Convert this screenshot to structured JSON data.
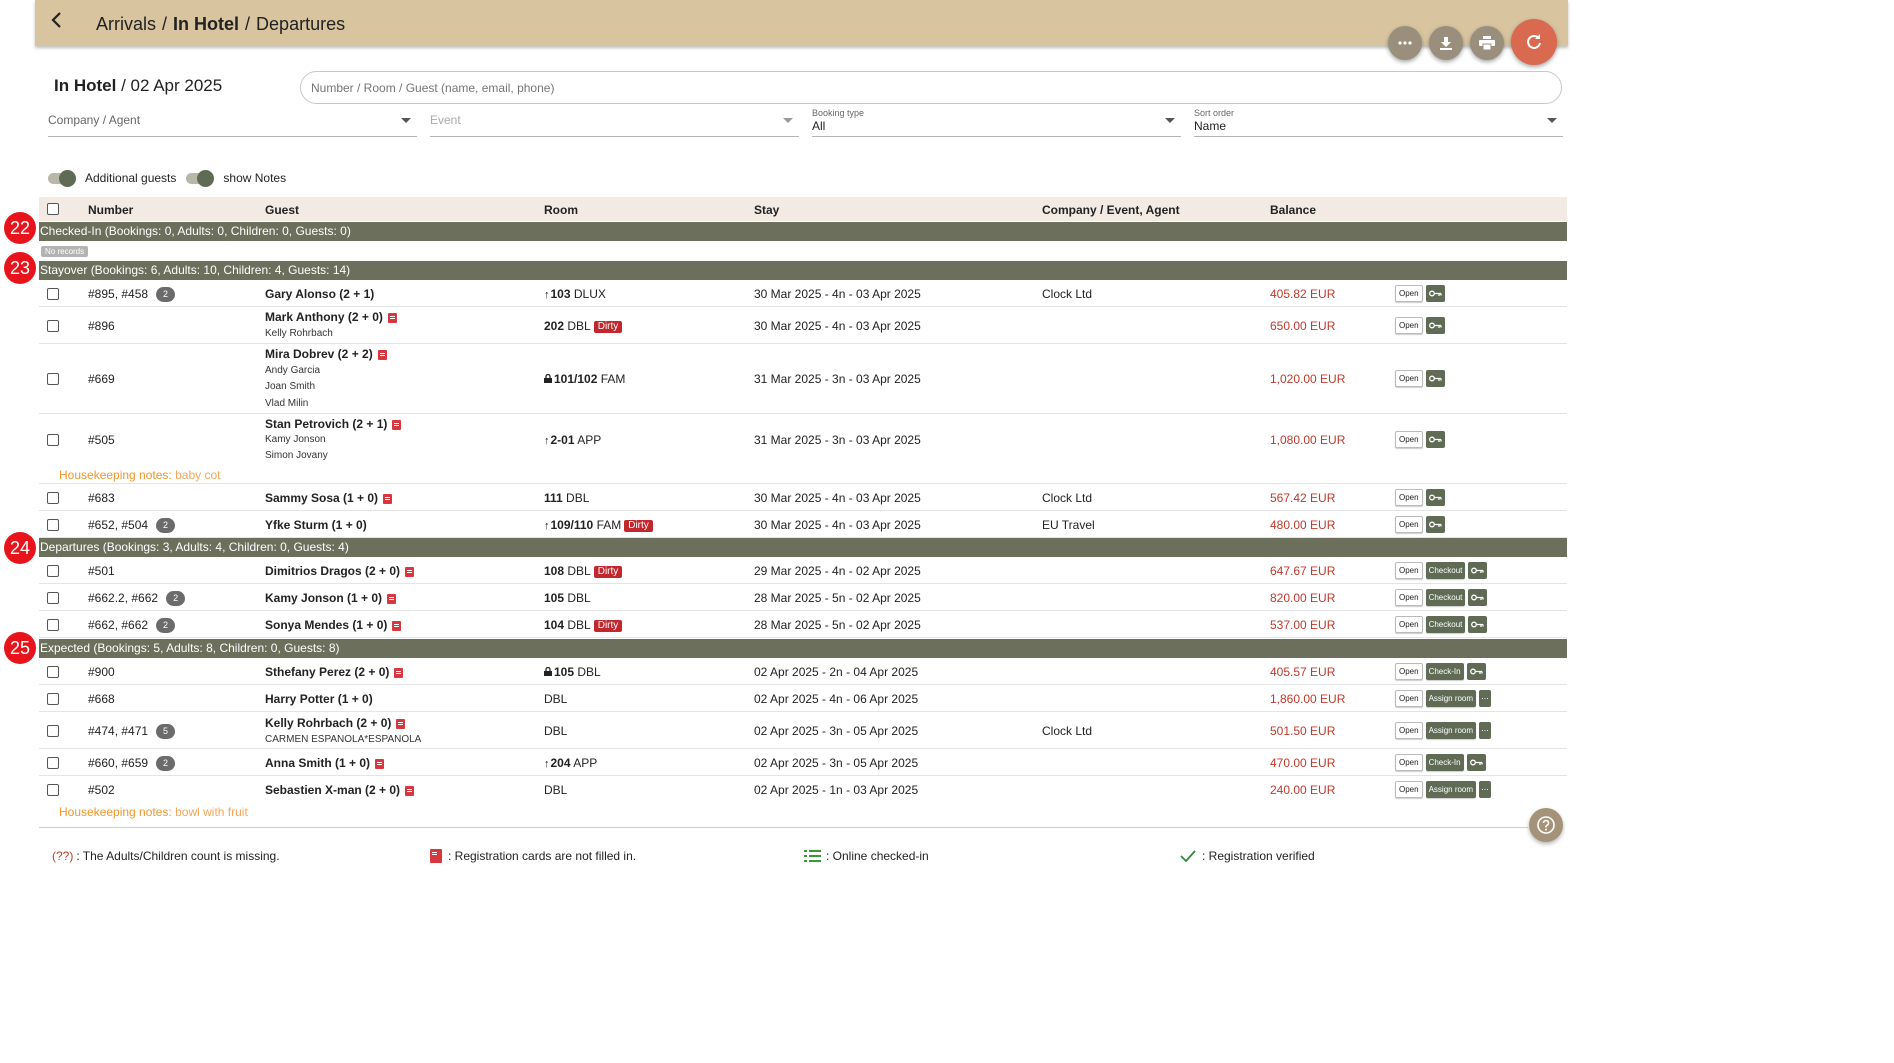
{
  "breadcrumb": {
    "item1": "Arrivals",
    "item2": "In Hotel",
    "item3": "Departures",
    "sep": "/"
  },
  "title": {
    "name": "In Hotel",
    "date": "02 Apr 2025"
  },
  "search": {
    "placeholder": "Number / Room / Guest (name, email, phone)"
  },
  "filters": {
    "company": {
      "label": "Company / Agent"
    },
    "event": {
      "label": "Event"
    },
    "booking_type": {
      "label": "Booking type",
      "value": "All"
    },
    "sort": {
      "label": "Sort order",
      "value": "Name"
    }
  },
  "toggles": {
    "additional_guests": "Additional guests",
    "show_notes": "show Notes"
  },
  "columns": {
    "number": "Number",
    "guest": "Guest",
    "room": "Room",
    "stay": "Stay",
    "company": "Company / Event, Agent",
    "balance": "Balance"
  },
  "buttons": {
    "open": "Open",
    "checkout": "Checkout",
    "checkin": "Check-In",
    "assign": "Assign room",
    "more": "..."
  },
  "sections": {
    "checked_in": {
      "num": "22",
      "label": "Checked-In (Bookings: 0, Adults: 0, Children: 0, Guests: 0)",
      "no_records": "No records"
    },
    "stayover": {
      "num": "23",
      "label": "Stayover (Bookings: 6, Adults: 10, Children: 4, Guests: 14)"
    },
    "departures": {
      "num": "24",
      "label": "Departures (Bookings: 3, Adults: 4, Children: 0, Guests: 4)"
    },
    "expected": {
      "num": "25",
      "label": "Expected (Bookings: 5, Adults: 8, Children: 0, Guests: 8)"
    }
  },
  "stayover_rows": [
    {
      "number": "#895, #458",
      "count": "2",
      "guest": "Gary Alonso (2 + 1)",
      "room_num": "103",
      "room_type": "DLUX",
      "stay": "30 Mar 2025 - 4n - 03 Apr 2025",
      "company": "Clock Ltd",
      "balance": "405.82 EUR"
    },
    {
      "number": "#896",
      "guest": "Mark Anthony (2 + 0)",
      "sub1": "Kelly Rohrbach",
      "room_num": "202",
      "room_type": "DBL",
      "dirty": "Dirty",
      "stay": "30 Mar 2025 - 4n - 03 Apr 2025",
      "balance": "650.00 EUR"
    },
    {
      "number": "#669",
      "guest": "Mira Dobrev (2 + 2)",
      "sub1": "Andy Garcia",
      "sub2": "Joan Smith",
      "sub3": "Vlad Milin",
      "room_num": "101/102",
      "room_type": "FAM",
      "stay": "31 Mar 2025 - 3n - 03 Apr 2025",
      "balance": "1,020.00 EUR"
    },
    {
      "number": "#505",
      "guest": "Stan Petrovich (2 + 1)",
      "sub1": "Kamy Jonson",
      "sub2": "Simon Jovany",
      "room_num": "2-01",
      "room_type": "APP",
      "stay": "31 Mar 2025 - 3n - 03 Apr 2025",
      "balance": "1,080.00 EUR",
      "hk_label": "Housekeeping notes:",
      "hk_value": "baby cot"
    },
    {
      "number": "#683",
      "guest": "Sammy Sosa (1 + 0)",
      "room_num": "111",
      "room_type": "DBL",
      "stay": "30 Mar 2025 - 4n - 03 Apr 2025",
      "company": "Clock Ltd",
      "balance": "567.42 EUR"
    },
    {
      "number": "#652, #504",
      "count": "2",
      "guest": "Yfke Sturm (1 + 0)",
      "room_num": "109/110",
      "room_type": "FAM",
      "dirty": "Dirty",
      "stay": "30 Mar 2025 - 4n - 03 Apr 2025",
      "company": "EU Travel",
      "balance": "480.00 EUR"
    }
  ],
  "departure_rows": [
    {
      "number": "#501",
      "guest": "Dimitrios Dragos (2 + 0)",
      "room_num": "108",
      "room_type": "DBL",
      "dirty": "Dirty",
      "stay": "29 Mar 2025 - 4n - 02 Apr 2025",
      "balance": "647.67 EUR"
    },
    {
      "number": "#662.2, #662",
      "count": "2",
      "guest": "Kamy Jonson (1 + 0)",
      "room_num": "105",
      "room_type": "DBL",
      "stay": "28 Mar 2025 - 5n - 02 Apr 2025",
      "balance": "820.00 EUR"
    },
    {
      "number": "#662, #662",
      "count": "2",
      "guest": "Sonya Mendes (1 + 0)",
      "room_num": "104",
      "room_type": "DBL",
      "dirty": "Dirty",
      "stay": "28 Mar 2025 - 5n - 02 Apr 2025",
      "balance": "537.00 EUR"
    }
  ],
  "expected_rows": [
    {
      "number": "#900",
      "guest": "Sthefany Perez (2 + 0)",
      "room_num": "105",
      "room_type": "DBL",
      "stay": "02 Apr 2025 - 2n - 04 Apr 2025",
      "balance": "405.57 EUR"
    },
    {
      "number": "#668",
      "guest": "Harry Potter (1 + 0)",
      "room_type": "DBL",
      "stay": "02 Apr 2025 - 4n - 06 Apr 2025",
      "balance": "1,860.00 EUR"
    },
    {
      "number": "#474, #471",
      "count": "5",
      "guest": "Kelly Rohrbach (2 + 0)",
      "sub1": "CARMEN ESPANOLA*ESPANOLA",
      "room_type": "DBL",
      "stay": "02 Apr 2025 - 3n - 05 Apr 2025",
      "company": "Clock Ltd",
      "balance": "501.50 EUR"
    },
    {
      "number": "#660, #659",
      "count": "2",
      "guest": "Anna Smith (1 + 0)",
      "room_num": "204",
      "room_type": "APP",
      "stay": "02 Apr 2025 - 3n - 05 Apr 2025",
      "balance": "470.00 EUR"
    },
    {
      "number": "#502",
      "guest": "Sebastien X-man (2 + 0)",
      "room_type": "DBL",
      "stay": "02 Apr 2025 - 1n - 03 Apr 2025",
      "balance": "240.00 EUR",
      "hk_label": "Housekeeping notes:",
      "hk_value": "bowl with fruit"
    }
  ],
  "legend": {
    "missing_mark": "(??)",
    "missing_text": ": The Adults/Children count is missing.",
    "regcards": ": Registration cards are not filled in.",
    "online": ": Online checked-in",
    "verified": ": Registration verified"
  },
  "colors": {
    "header_bg": "#d8c49f",
    "section_bg": "#6b6f5b",
    "balance": "#c0392b",
    "refresh": "#d9694f",
    "marker": "#e8141c"
  }
}
